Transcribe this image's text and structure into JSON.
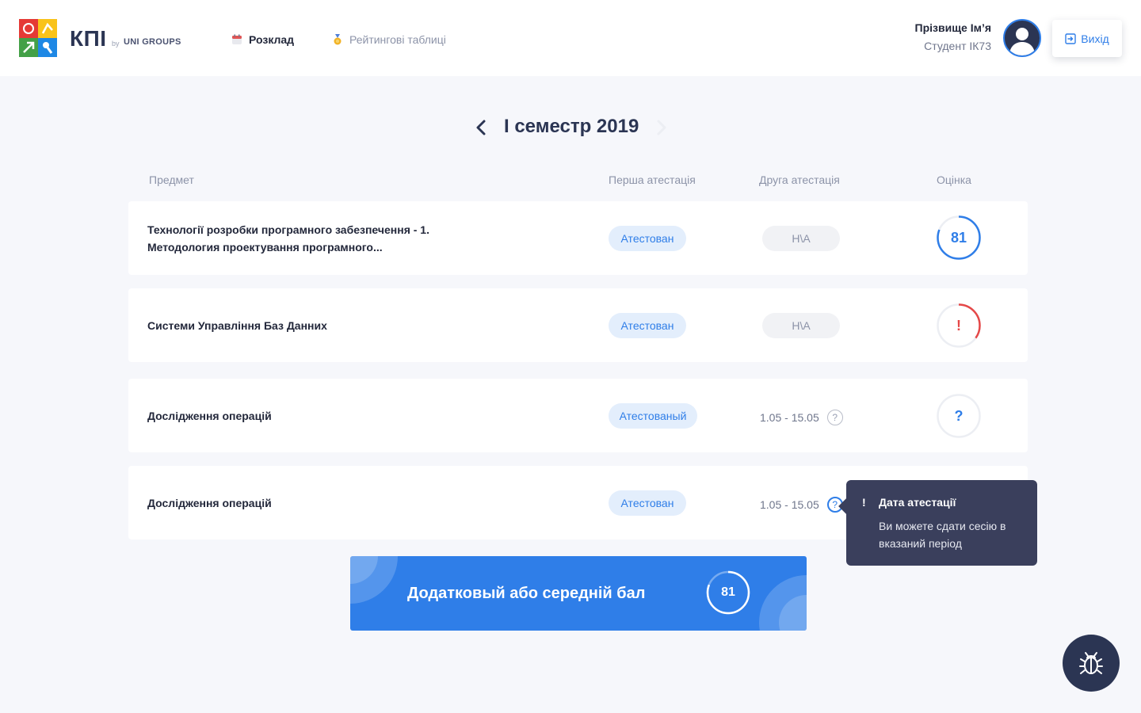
{
  "header": {
    "logo_text": "КПІ",
    "logo_by": "by",
    "logo_group": "UNI GROUPS",
    "nav": [
      {
        "label": "Розклад",
        "icon": "calendar-icon",
        "active": true
      },
      {
        "label": "Рейтингові таблиці",
        "icon": "medal-icon",
        "active": false
      }
    ],
    "user": {
      "name": "Прізвище Ім’я",
      "group": "Студент ІК73"
    },
    "logout_label": "Вихід"
  },
  "semester": {
    "title": "І семестр 2019"
  },
  "table": {
    "headers": {
      "subject": "Предмет",
      "first": "Перша атестація",
      "second": "Друга атестація",
      "grade": "Оцінка"
    },
    "rows": [
      {
        "subject_line1": "Технології розробки програмного забезпечення - 1.",
        "subject_line2": "Методология проектування програмного...",
        "first": "Атестован",
        "second": "Н\\А",
        "grade": "81",
        "grade_progress": 0.81,
        "grade_status": "ok"
      },
      {
        "subject_line1": "Системи Управління Баз Данних",
        "subject_line2": "",
        "first": "Атестован",
        "second": "Н\\А",
        "grade": "!",
        "grade_progress": 0.35,
        "grade_status": "warning"
      },
      {
        "subject_line1": "Дослідження операцій",
        "subject_line2": "",
        "first": "Атестованый",
        "second": "1.05 - 15.05",
        "second_hint": "?",
        "grade": "?",
        "grade_progress": 0,
        "grade_status": "unknown"
      },
      {
        "subject_line1": "Дослідження операцій",
        "subject_line2": "",
        "first": "Атестован",
        "second": "1.05 - 15.05",
        "second_hint": "?",
        "grade": "",
        "grade_progress": 0,
        "grade_status": "hidden"
      }
    ]
  },
  "tooltip": {
    "mark": "!",
    "title": "Дата атестації",
    "text": "Ви можете сдати сесію в вказаний період"
  },
  "summary": {
    "label": "Додатковый або середній бал",
    "grade": "81",
    "grade_progress": 0.81
  },
  "colors": {
    "accent": "#2f7ee8",
    "danger": "#e54848",
    "dark": "#2b3553",
    "tooltip": "#3a3f5c"
  }
}
